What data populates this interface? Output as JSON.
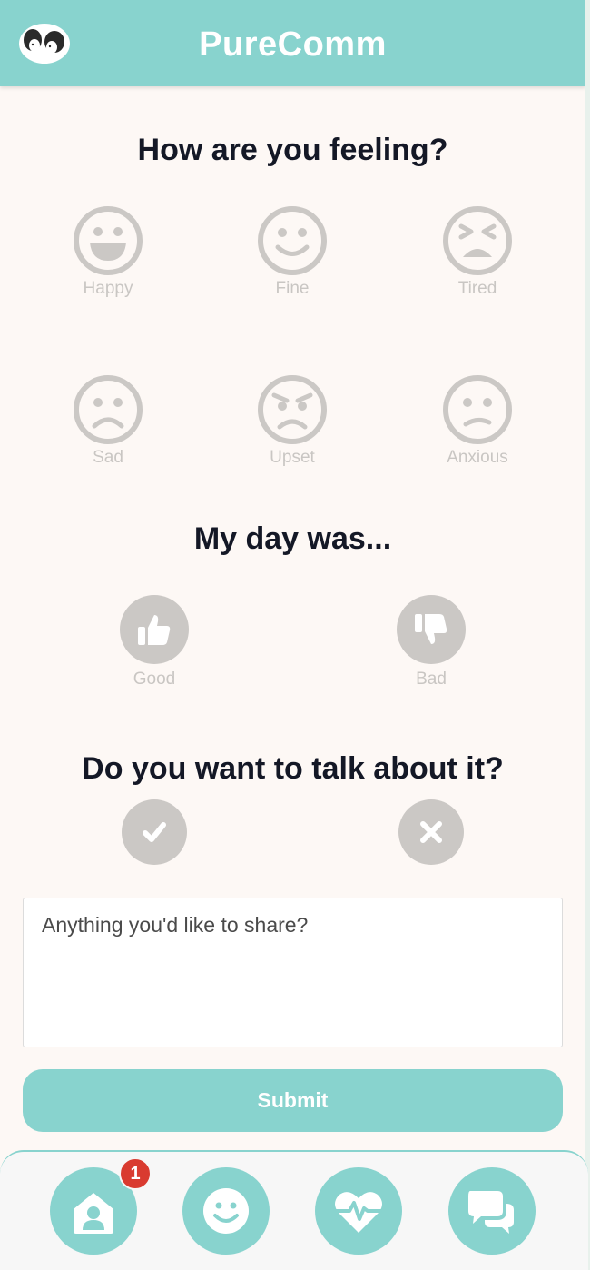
{
  "app": {
    "title": "PureComm"
  },
  "feeling": {
    "heading": "How are you feeling?",
    "moods": [
      {
        "label": "Happy",
        "icon": "grin-face-icon"
      },
      {
        "label": "Fine",
        "icon": "smile-face-icon"
      },
      {
        "label": "Tired",
        "icon": "tired-face-icon"
      },
      {
        "label": "Sad",
        "icon": "frown-face-icon"
      },
      {
        "label": "Upset",
        "icon": "angry-face-icon"
      },
      {
        "label": "Anxious",
        "icon": "worried-face-icon"
      }
    ]
  },
  "day": {
    "heading": "My day was...",
    "options": [
      {
        "label": "Good",
        "icon": "thumbs-up-icon"
      },
      {
        "label": "Bad",
        "icon": "thumbs-down-icon"
      }
    ]
  },
  "talk": {
    "heading": "Do you want to talk about it?",
    "options": [
      {
        "icon": "check-icon"
      },
      {
        "icon": "close-icon"
      }
    ]
  },
  "share": {
    "placeholder": "Anything you'd like to share?",
    "value": ""
  },
  "submit": {
    "label": "Submit"
  },
  "nav": {
    "items": [
      {
        "icon": "home-icon",
        "badge": "1"
      },
      {
        "icon": "smile-icon"
      },
      {
        "icon": "heart-pulse-icon"
      },
      {
        "icon": "chat-icon"
      }
    ]
  },
  "colors": {
    "accent": "#88d3ce",
    "inactive": "#cbc8c5",
    "text": "#141826",
    "badge": "#d93b30",
    "background": "#fdf8f5"
  }
}
